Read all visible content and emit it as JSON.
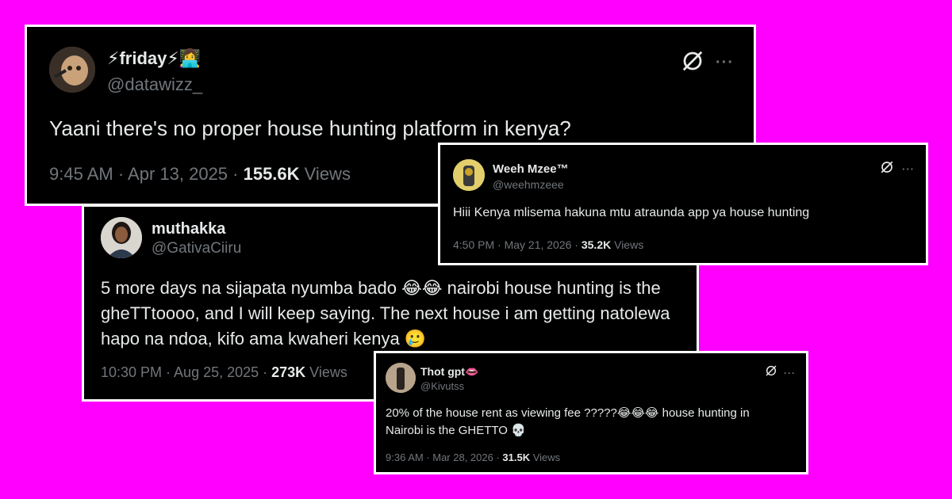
{
  "tweets": [
    {
      "name": "⚡friday⚡👩‍💻",
      "handle": "@datawizz_",
      "text": "Yaani there's no proper  house hunting platform in kenya?",
      "time": "9:45 AM · Apr 13, 2025 · ",
      "views_count": "155.6K",
      "views_label": " Views"
    },
    {
      "name": "muthakka",
      "handle": "@GativaCiiru",
      "text": "5 more days na sijapata nyumba bado 😂😂 nairobi house hunting is the\ngheTTtoooo,  and I will keep saying. The next house i am getting natolewa\nhapo na ndoa, kifo ama kwaheri kenya 🥲",
      "time": "10:30 PM · Aug 25, 2025 · ",
      "views_count": "273K",
      "views_label": " Views"
    },
    {
      "name": "Weeh Mzee™",
      "handle": "@weehmzeee",
      "text": "Hiii Kenya mlisema hakuna mtu atraunda app ya house hunting",
      "time": "4:50 PM · May 21, 2026 · ",
      "views_count": "35.2K",
      "views_label": " Views"
    },
    {
      "name": "Thot gpt👄",
      "handle": "@Kivutss",
      "text": "20% of the house rent as viewing fee ?????😂😂😂 house hunting in\nNairobi is the GHETTO 💀",
      "time": "9:36 AM · Mar 28, 2026 · ",
      "views_count": "31.5K",
      "views_label": " Views"
    }
  ],
  "icons": {
    "grok": "grok-icon",
    "more": "more-options-icon",
    "more_glyph": "···"
  },
  "colors": {
    "background": "#ff00ff",
    "card": "#000000",
    "text": "#e7e9ea",
    "muted": "#71767b"
  }
}
